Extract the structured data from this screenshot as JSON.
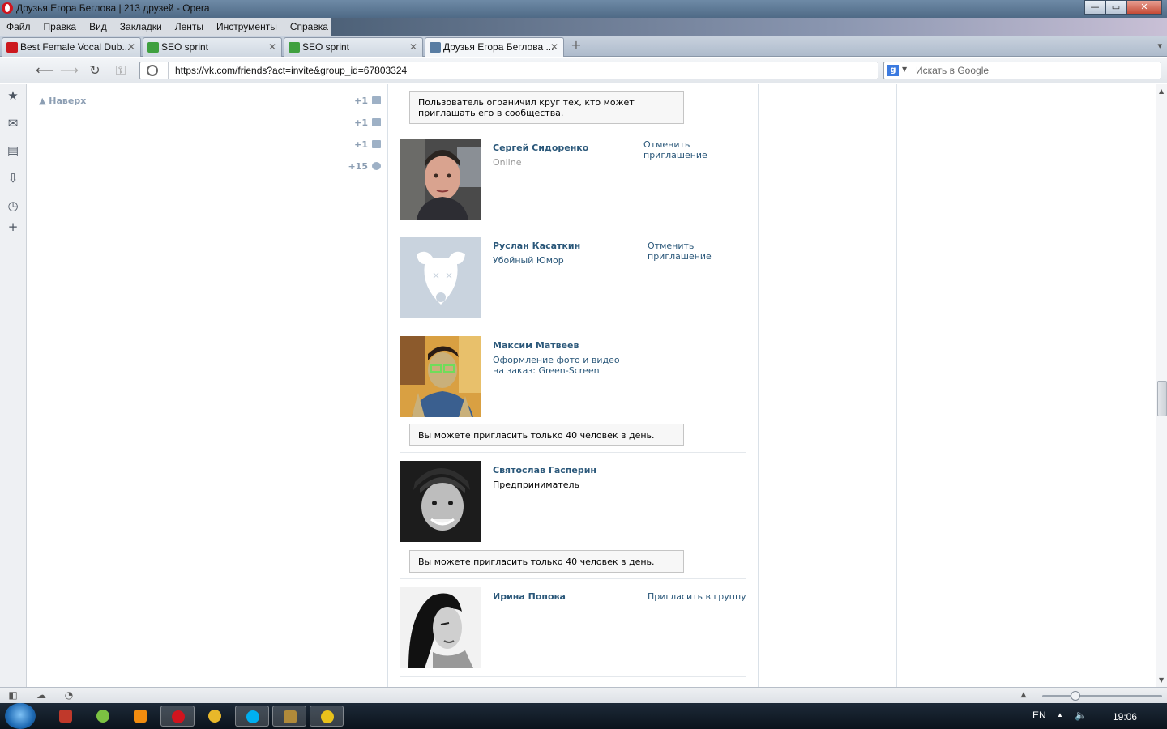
{
  "window": {
    "title": "Друзья Егора Беглова | 213 друзей - Opera",
    "controls": {
      "minimize": "—",
      "maximize": "▭",
      "close": "✕"
    }
  },
  "menu": [
    "Файл",
    "Правка",
    "Вид",
    "Закладки",
    "Ленты",
    "Инструменты",
    "Справка"
  ],
  "tabs": [
    {
      "label": "Best Female Vocal Dub...",
      "icon": "youtube-icon",
      "color": "#cc181e"
    },
    {
      "label": "SEO sprint",
      "icon": "seosprint-icon",
      "color": "#3fa03f"
    },
    {
      "label": "SEO sprint",
      "icon": "seosprint-icon",
      "color": "#3fa03f"
    },
    {
      "label": "Друзья Егора Беглова ...",
      "icon": "vk-icon",
      "color": "#597da3",
      "active": true
    }
  ],
  "address": {
    "url": "https://vk.com/friends?act=invite&group_id=67803324",
    "search_placeholder": "Искать в Google"
  },
  "left": {
    "up_label": "Наверх",
    "counters": [
      {
        "value": "+1",
        "icon": "message-icon"
      },
      {
        "value": "+1",
        "icon": "friends-icon"
      },
      {
        "value": "+1",
        "icon": "comment-icon"
      },
      {
        "value": "+15",
        "icon": "settings-icon"
      }
    ]
  },
  "notices": {
    "restricted": "Пользователь ограничил круг тех, кто может приглашать его в сообщества.",
    "limit1": "Вы можете пригласить только 40 человек в день.",
    "limit2": "Вы можете пригласить только 40 человек в день."
  },
  "friends": [
    {
      "name": "Сергей Сидоренко",
      "sub": "Online",
      "action": "Отменить приглашение"
    },
    {
      "name": "Руслан Касаткин",
      "sub": "Убойный Юмор",
      "action": "Отменить приглашение"
    },
    {
      "name": "Максим Матвеев",
      "sub": "Оформление фото и видео на заказ: Green-Screen",
      "action": ""
    },
    {
      "name": "Святослав Гасперин",
      "sub": "Предприниматель",
      "action": ""
    },
    {
      "name": "Ирина Попова",
      "sub": "",
      "action": "Пригласить в группу"
    }
  ],
  "taskbar": {
    "lang": "EN",
    "time": "19:06",
    "apps": [
      "filezilla",
      "chrome-like",
      "odnoklassniki",
      "opera",
      "chrome",
      "skype",
      "warcraft",
      "radiation"
    ]
  },
  "colors": {
    "link": "#2b587a",
    "muted": "#8c9eb3",
    "border": "#dae1e8"
  }
}
